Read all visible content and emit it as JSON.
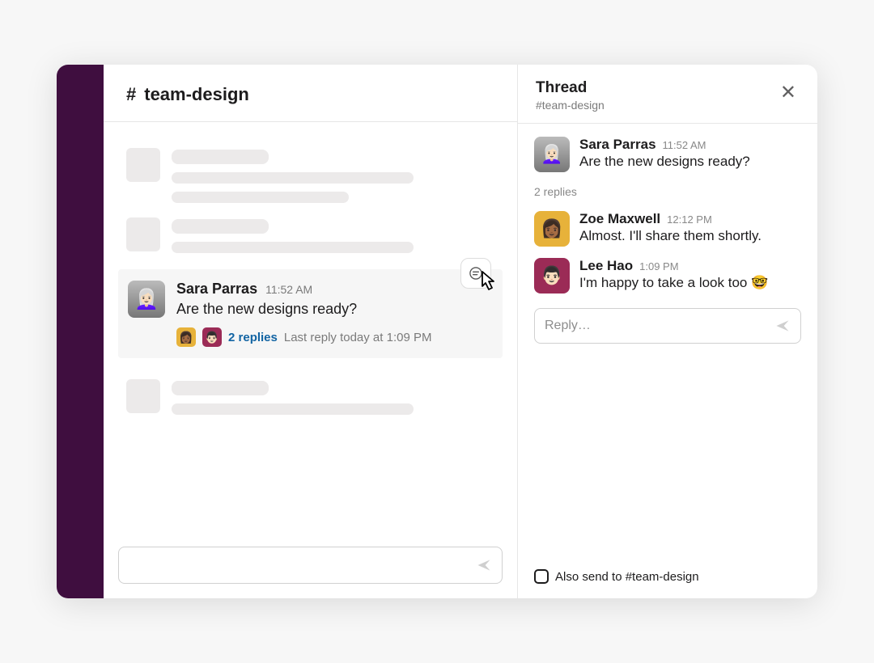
{
  "channel": {
    "hash_glyph": "#",
    "name": "team-design",
    "active_message": {
      "author": "Sara Parras",
      "time": "11:52 AM",
      "text": "Are the new designs ready?",
      "replies_count_label": "2 replies",
      "last_reply_label": "Last reply today at 1:09 PM",
      "reply_avatars": [
        "zoe",
        "lee"
      ]
    },
    "action_icon": "reply-thread-icon",
    "composer_send_glyph": "➤"
  },
  "thread": {
    "title": "Thread",
    "subtitle": "#team-design",
    "close_glyph": "✕",
    "reply_count_label": "2 replies",
    "messages": [
      {
        "author": "Sara Parras",
        "time": "11:52 AM",
        "text": "Are the new designs ready?",
        "avatar": "sara"
      },
      {
        "author": "Zoe Maxwell",
        "time": "12:12 PM",
        "text": "Almost. I'll share them shortly.",
        "avatar": "zoe"
      },
      {
        "author": "Lee Hao",
        "time": "1:09 PM",
        "text": "I'm happy to take a look too 🤓",
        "avatar": "lee"
      }
    ],
    "composer_placeholder": "Reply…",
    "also_send_label": "Also send to #team-design"
  },
  "avatars": {
    "sara": "👩🏻‍🦳",
    "zoe": "👩🏾",
    "lee": "👨🏻"
  }
}
